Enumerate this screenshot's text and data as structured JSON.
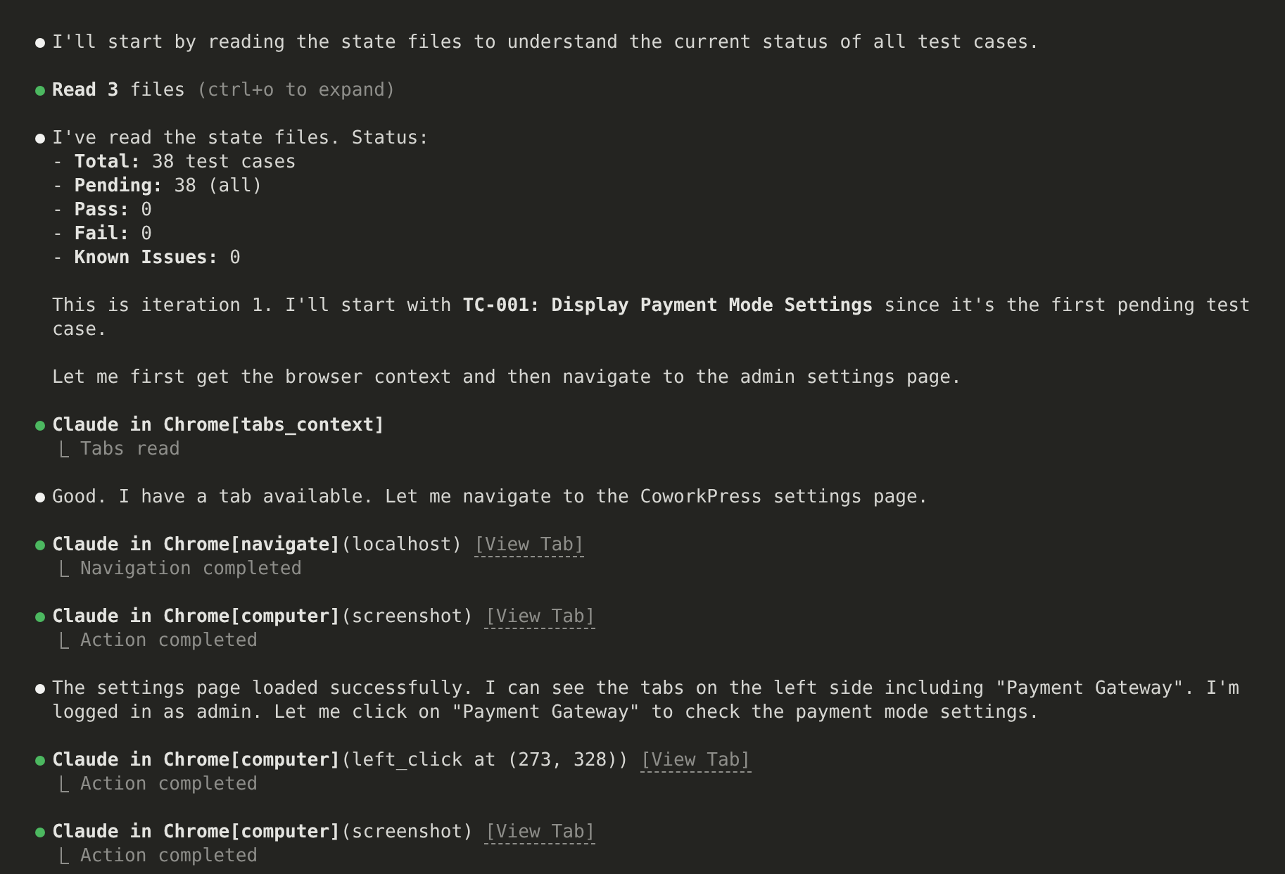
{
  "entries": [
    {
      "kind": "message",
      "blocks": [
        {
          "kind": "text",
          "text": "I'll start by reading the state files to understand the current status of all test cases."
        }
      ]
    },
    {
      "kind": "tool",
      "title": "**Read 3** files",
      "hint": "(ctrl+o to expand)"
    },
    {
      "kind": "message",
      "blocks": [
        {
          "kind": "text",
          "text": "I've read the state files. Status:"
        },
        {
          "kind": "bullets",
          "items": [
            "- **Total:** 38 test cases",
            "- **Pending:** 38 (all)",
            "- **Pass:** 0",
            "- **Fail:** 0",
            "- **Known Issues:** 0"
          ]
        },
        {
          "kind": "text",
          "text": "This is iteration 1. I'll start with **TC-001: Display Payment Mode Settings** since it's the first pending test case."
        },
        {
          "kind": "text",
          "text": "Let me first get the browser context and then navigate to the admin settings page."
        }
      ]
    },
    {
      "kind": "tool",
      "title": "**Claude in Chrome[tabs_context]**",
      "result": "Tabs read"
    },
    {
      "kind": "message",
      "blocks": [
        {
          "kind": "text",
          "text": "Good. I have a tab available. Let me navigate to the CoworkPress settings page."
        }
      ]
    },
    {
      "kind": "tool",
      "title": "**Claude in Chrome[navigate]**(localhost)",
      "link": "[View Tab]",
      "result": "Navigation completed"
    },
    {
      "kind": "tool",
      "title": "**Claude in Chrome[computer]**(screenshot)",
      "link": "[View Tab]",
      "result": "Action completed"
    },
    {
      "kind": "message",
      "blocks": [
        {
          "kind": "text",
          "text": "The settings page loaded successfully. I can see the tabs on the left side including \"Payment Gateway\". I'm logged in as admin. Let me click on \"Payment Gateway\" to check the payment mode settings."
        }
      ]
    },
    {
      "kind": "tool",
      "title": "**Claude in Chrome[computer]**(left_click at (273, 328))",
      "link": "[View Tab]",
      "result": "Action completed"
    },
    {
      "kind": "tool",
      "title": "**Claude in Chrome[computer]**(screenshot)",
      "link": "[View Tab]",
      "result": "Action completed"
    }
  ]
}
